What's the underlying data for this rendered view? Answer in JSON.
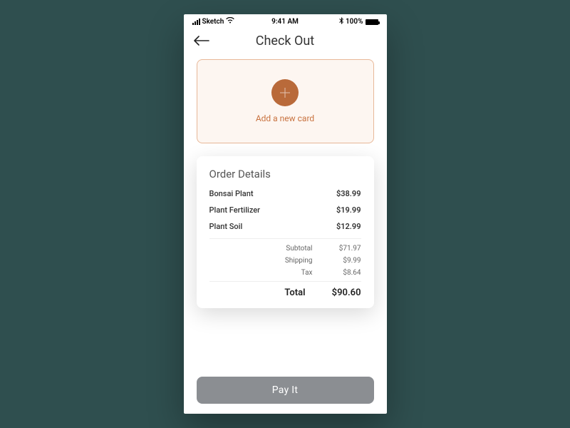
{
  "statusBar": {
    "carrier": "Sketch",
    "time": "9:41 AM",
    "batteryPct": "100%"
  },
  "header": {
    "title": "Check Out"
  },
  "addCard": {
    "label": "Add a new card"
  },
  "order": {
    "title": "Order Details",
    "items": [
      {
        "name": "Bonsai Plant",
        "price": "$38.99"
      },
      {
        "name": "Plant Fertilizer",
        "price": "$19.99"
      },
      {
        "name": "Plant Soil",
        "price": "$12.99"
      }
    ],
    "subtotal": {
      "label": "Subtotal",
      "value": "$71.97"
    },
    "shipping": {
      "label": "Shipping",
      "value": "$9.99"
    },
    "tax": {
      "label": "Tax",
      "value": "$8.64"
    },
    "total": {
      "label": "Total",
      "value": "$90.60"
    }
  },
  "payButton": {
    "label": "Pay It"
  }
}
